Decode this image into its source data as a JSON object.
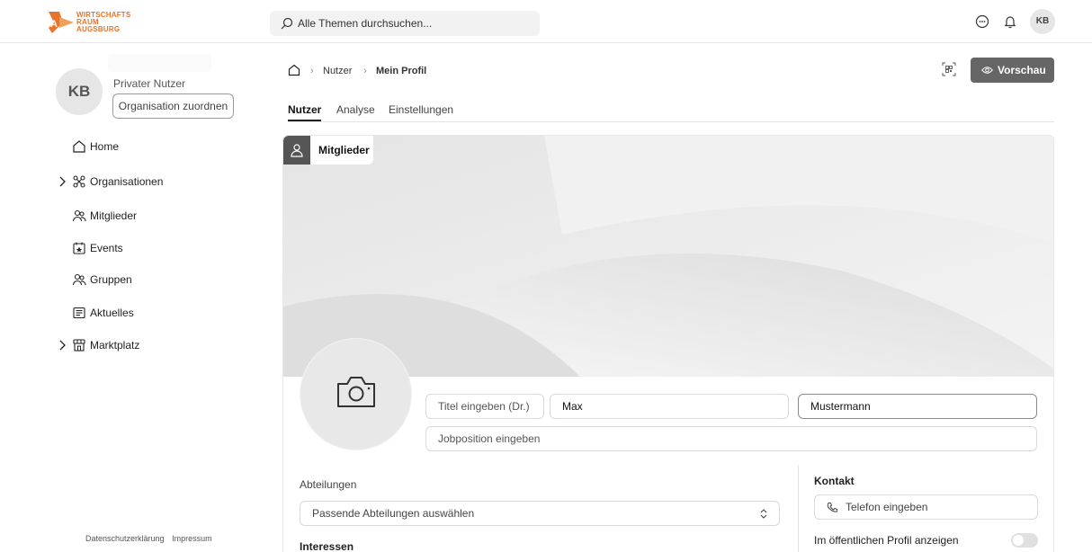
{
  "brand": {
    "logo_line1": "WIRTSCHAFTS",
    "logo_line2": "RAUM",
    "logo_line3": "AUGSBURG",
    "accent": "#e8732a"
  },
  "header": {
    "search_placeholder": "Alle Themen durchsuchen...",
    "icons": [
      "chat-icon",
      "bell-icon"
    ],
    "avatar_initials": "KB"
  },
  "sidebar": {
    "avatar_initials": "KB",
    "user_role": "Privater Nutzer",
    "org_button": "Organisation zuordnen",
    "items": [
      {
        "label": "Home",
        "icon": "home-icon",
        "expandable": false
      },
      {
        "label": "Organisationen",
        "icon": "organisation-icon",
        "expandable": true
      },
      {
        "label": "Mitglieder",
        "icon": "members-icon",
        "expandable": false
      },
      {
        "label": "Events",
        "icon": "events-icon",
        "expandable": false
      },
      {
        "label": "Gruppen",
        "icon": "groups-icon",
        "expandable": false
      },
      {
        "label": "Aktuelles",
        "icon": "news-icon",
        "expandable": false
      },
      {
        "label": "Marktplatz",
        "icon": "marketplace-icon",
        "expandable": true
      }
    ],
    "footer": {
      "privacy": "Datenschutzerklärung",
      "imprint": "Impressum"
    }
  },
  "breadcrumb": {
    "level1": "Nutzer",
    "level2": "Mein Profil"
  },
  "actions": {
    "preview_label": "Vorschau"
  },
  "tabs": [
    {
      "label": "Nutzer",
      "active": true
    },
    {
      "label": "Analyse",
      "active": false
    },
    {
      "label": "Einstellungen",
      "active": false
    }
  ],
  "profile": {
    "banner_chip": "Mitglieder",
    "title_placeholder": "Titel eingeben (Dr.)",
    "first_name": "Max",
    "last_name": "Mustermann",
    "job_placeholder": "Jobposition eingeben",
    "departments_label": "Abteilungen",
    "departments_placeholder": "Passende Abteilungen auswählen",
    "interests_label": "Interessen",
    "contact_label": "Kontakt",
    "phone_placeholder": "Telefon eingeben",
    "public_profile_label": "Im öffentlichen Profil anzeigen",
    "public_profile_on": false
  }
}
